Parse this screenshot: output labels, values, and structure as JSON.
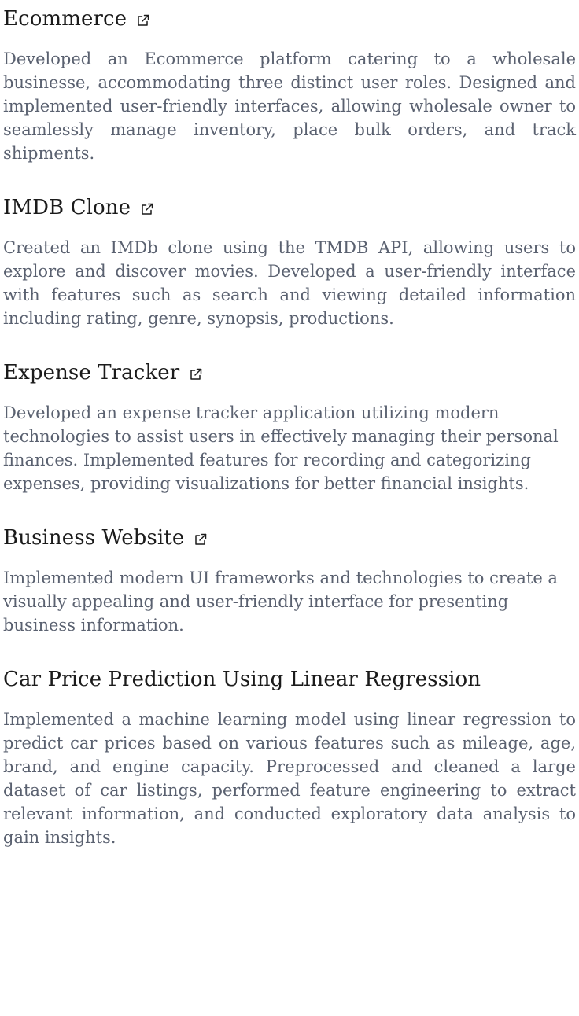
{
  "projects": [
    {
      "title": "Ecommerce",
      "icon": "external-link-icon",
      "description": "Developed an Ecommerce platform catering to a wholesale businesse, accommodating three distinct user roles. Designed and implemented user-friendly interfaces, allowing wholesale owner to seamlessly manage inventory, place bulk orders, and track shipments."
    },
    {
      "title": "IMDB Clone",
      "icon": "external-link-icon",
      "description": "Created an IMDb clone using the TMDB API, allowing users to explore and discover movies. Developed a user-friendly interface with features such as search and viewing detailed information including rating, genre, synopsis, productions."
    },
    {
      "title": "Expense Tracker",
      "icon": "external-link-icon",
      "description": "Developed an expense tracker application utilizing modern technologies to assist users in effectively managing their personal finances. Implemented features for recording and categorizing expenses, providing visualizations for better financial insights."
    },
    {
      "title": "Business Website",
      "icon": "external-link-icon",
      "description": "Implemented modern UI frameworks and technologies to create a visually appealing and user-friendly interface for presenting business information."
    },
    {
      "title": "Car Price Prediction Using Linear Regression",
      "description": "Implemented a machine learning model using linear regression to predict car prices based on various features such as mileage, age, brand, and engine capacity. Preprocessed and cleaned a large dataset of car listings, performed feature engineering to extract relevant information, and conducted exploratory data analysis to gain insights."
    }
  ],
  "colors": {
    "title": "#1b1b1b",
    "description": "#5a6170"
  }
}
